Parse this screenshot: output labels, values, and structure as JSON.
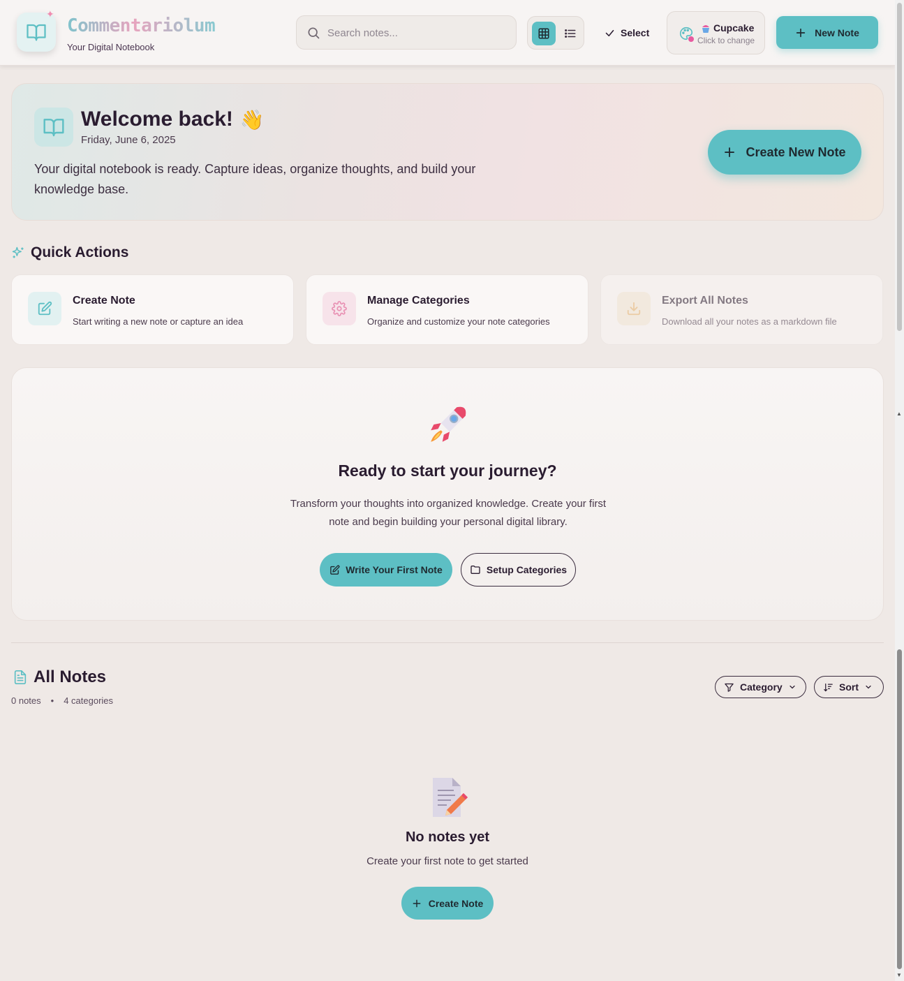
{
  "header": {
    "brand_title": "Commentariolum",
    "brand_subtitle": "Your Digital Notebook",
    "search_placeholder": "Search notes...",
    "select_label": "Select",
    "theme_name": "Cupcake",
    "theme_hint": "Click to change",
    "new_note_label": "New Note",
    "active_view": "grid"
  },
  "welcome": {
    "title": "Welcome back!",
    "emoji": "👋",
    "date": "Friday, June 6, 2025",
    "text": "Your digital notebook is ready. Capture ideas, organize thoughts, and build your knowledge base.",
    "cta_label": "Create New Note"
  },
  "quick_actions": {
    "heading": "Quick Actions",
    "items": [
      {
        "title": "Create Note",
        "desc": "Start writing a new note or capture an idea",
        "icon": "edit-icon",
        "enabled": true
      },
      {
        "title": "Manage Categories",
        "desc": "Organize and customize your note categories",
        "icon": "gear-icon",
        "enabled": true
      },
      {
        "title": "Export All Notes",
        "desc": "Download all your notes as a markdown file",
        "icon": "download-icon",
        "enabled": false
      }
    ]
  },
  "journey": {
    "title": "Ready to start your journey?",
    "text": "Transform your thoughts into organized knowledge. Create your first note and begin building your personal digital library.",
    "primary_label": "Write Your First Note",
    "secondary_label": "Setup Categories"
  },
  "all_notes": {
    "title": "All Notes",
    "notes_count": "0 notes",
    "separator": "•",
    "categories_count": "4 categories",
    "category_filter_label": "Category",
    "sort_label": "Sort",
    "empty_title": "No notes yet",
    "empty_text": "Create your first note to get started",
    "empty_cta_label": "Create Note"
  },
  "colors": {
    "accent": "#5dbfc4",
    "background": "#efe9e6",
    "text": "#2a1c30",
    "pink": "#e7a4be"
  }
}
